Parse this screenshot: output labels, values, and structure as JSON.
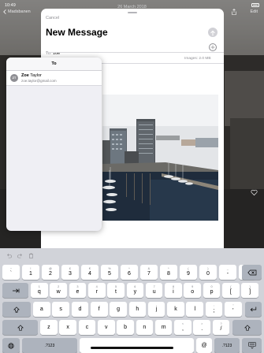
{
  "status_bar": {
    "time": "10:49",
    "date": "26 March 2018"
  },
  "background_app": {
    "back_label": "Madsbanen",
    "edit_label": "Edit"
  },
  "compose": {
    "cancel_label": "Cancel",
    "title": "New Message",
    "to_label": "To:",
    "to_value": "zoe",
    "images_label": "Images:",
    "images_size": "2.0 MB"
  },
  "to_popover": {
    "header": "To",
    "contacts": [
      {
        "initials": "ZT",
        "first_name": "Zoe",
        "last_name": "Taylor",
        "email": "zoe.taylor@gmail.com"
      }
    ]
  },
  "keyboard": {
    "row1": [
      {
        "alt": "1",
        "main": "q"
      },
      {
        "alt": "2",
        "main": "w"
      },
      {
        "alt": "3",
        "main": "e"
      },
      {
        "alt": "4",
        "main": "r"
      },
      {
        "alt": "5",
        "main": "t"
      },
      {
        "alt": "6",
        "main": "y"
      },
      {
        "alt": "7",
        "main": "u"
      },
      {
        "alt": "8",
        "main": "i"
      },
      {
        "alt": "9",
        "main": "o"
      },
      {
        "alt": "0",
        "main": "p"
      },
      {
        "alt": "{",
        "main": "["
      },
      {
        "alt": "}",
        "main": "]"
      }
    ],
    "row0": [
      {
        "alt": "~",
        "main": "`"
      },
      {
        "alt": "!",
        "main": "1"
      },
      {
        "alt": "@",
        "main": "2"
      },
      {
        "alt": "£",
        "main": "3"
      },
      {
        "alt": "€",
        "main": "4"
      },
      {
        "alt": "%",
        "main": "5"
      },
      {
        "alt": "^",
        "main": "6"
      },
      {
        "alt": "&",
        "main": "7"
      },
      {
        "alt": "*",
        "main": "8"
      },
      {
        "alt": "(",
        "main": "9"
      },
      {
        "alt": ")",
        "main": "0"
      },
      {
        "alt": "_",
        "main": "-"
      },
      {
        "alt": "+",
        "main": "="
      }
    ],
    "row2": [
      {
        "main": "a"
      },
      {
        "main": "s"
      },
      {
        "main": "d"
      },
      {
        "main": "f"
      },
      {
        "main": "g"
      },
      {
        "main": "h"
      },
      {
        "main": "j"
      },
      {
        "main": "k"
      },
      {
        "main": "l"
      },
      {
        "alt": ":",
        "main": ";"
      },
      {
        "alt": "\"",
        "main": "'"
      }
    ],
    "row3": [
      {
        "main": "z"
      },
      {
        "main": "x"
      },
      {
        "main": "c"
      },
      {
        "main": "v"
      },
      {
        "main": "b"
      },
      {
        "main": "n"
      },
      {
        "main": "m"
      },
      {
        "alt": "<",
        "main": ","
      },
      {
        "alt": ">",
        "main": "."
      },
      {
        "alt": "?",
        "main": "/"
      }
    ],
    "number_key_label": ".?123",
    "at_key_label": "@",
    "backslash_alt": "|",
    "backslash_main": "\\"
  }
}
